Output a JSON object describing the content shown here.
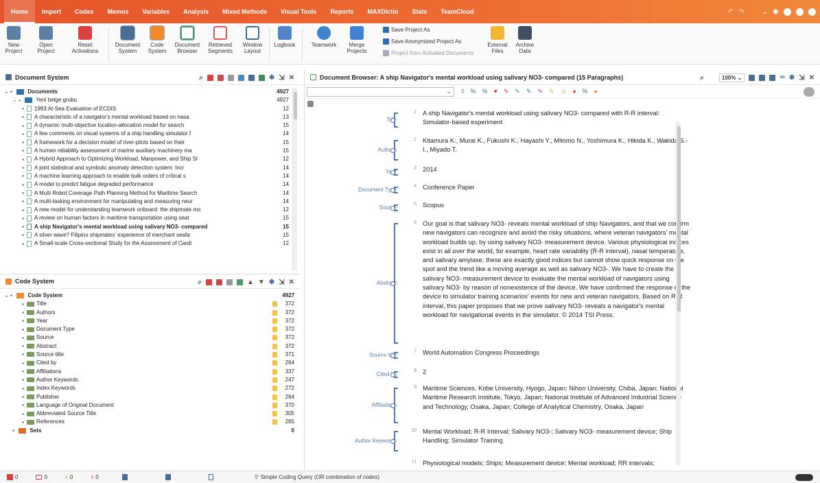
{
  "menu": {
    "items": [
      "Home",
      "Import",
      "Codes",
      "Memos",
      "Variables",
      "Analysis",
      "Mixed Methods",
      "Visual Tools",
      "Reports",
      "MAXDictio",
      "Stats",
      "TeamCloud"
    ]
  },
  "ribbon": {
    "new_project": "New\nProject",
    "open_project": "Open\nProject",
    "reset_activations": "Reset\nActivations",
    "document_system": "Document\nSystem",
    "code_system": "Code\nSystem",
    "document_browser": "Document\nBrowser",
    "retrieved_segments": "Retrieved\nSegments",
    "window_layout": "Window\nLayout",
    "logbook": "Logbook",
    "teamwork": "Teamwork",
    "merge_projects": "Merge\nProjects",
    "save_project_as": "Save Project As",
    "save_anonymized": "Save Anonymized Project As",
    "project_from_activated": "Project from Activated Documents",
    "external_files": "External\nFiles",
    "archive_data": "Archive\nData"
  },
  "doc_system": {
    "title": "Document System",
    "root": {
      "label": "Documents",
      "count": "4927"
    },
    "group": {
      "label": "Yeni belge grubu",
      "count": "4927"
    },
    "docs": [
      {
        "label": "1993 At-Sea Evaluation of ECDIS",
        "count": "12"
      },
      {
        "label": "A characteristic of a navigator's mental workload based on nasa",
        "count": "13"
      },
      {
        "label": "A dynamic multi-objective location-allocation model for search",
        "count": "15"
      },
      {
        "label": "A few comments on visual systems of a ship handling simulator f",
        "count": "14"
      },
      {
        "label": "A framework for a decision model of river-pilots based on their",
        "count": "15"
      },
      {
        "label": "A human reliability assessment of marine auxiliary machinery ma",
        "count": "15"
      },
      {
        "label": "A Hybrid Approach to Optimizing Workload, Manpower, and Ship Sl",
        "count": "12"
      },
      {
        "label": "A joint statistical and symbolic anomaly detection system: Incr",
        "count": "14"
      },
      {
        "label": "A machine learning approach to enable bulk orders of critical s",
        "count": "14"
      },
      {
        "label": "A model to predict fatigue degraded performance",
        "count": "14"
      },
      {
        "label": "A Multi Robot Coverage Path Planning Method for Maritime Search",
        "count": "14"
      },
      {
        "label": "A multi-tasking environment for manipulating and measuring neur",
        "count": "14"
      },
      {
        "label": "A new model for understanding teamwork onboard: the shipmate mo",
        "count": "12"
      },
      {
        "label": "A review on human factors in maritime transportation using seat",
        "count": "15"
      },
      {
        "label": "A ship Navigator's mental workload using salivary NO3- compared",
        "count": "15"
      },
      {
        "label": "A silver wave? Filipino shipmates' experience of merchant seafa",
        "count": "15"
      },
      {
        "label": "A Small-scale Cross-sectional Study for the Assessment of Cardi",
        "count": "12"
      }
    ]
  },
  "code_system": {
    "title": "Code System",
    "root": {
      "label": "Code System",
      "count": "4927"
    },
    "codes": [
      {
        "label": "Title",
        "count": "372"
      },
      {
        "label": "Authors",
        "count": "372"
      },
      {
        "label": "Year",
        "count": "372"
      },
      {
        "label": "Document Type",
        "count": "372"
      },
      {
        "label": "Source",
        "count": "372"
      },
      {
        "label": "Abstract",
        "count": "372"
      },
      {
        "label": "Source title",
        "count": "371"
      },
      {
        "label": "Cited by",
        "count": "264"
      },
      {
        "label": "Affiliations",
        "count": "337"
      },
      {
        "label": "Author Keywords",
        "count": "247"
      },
      {
        "label": "Index Keywords",
        "count": "272"
      },
      {
        "label": "Publisher",
        "count": "264"
      },
      {
        "label": "Language of Original Document",
        "count": "370"
      },
      {
        "label": "Abbreviated Source Title",
        "count": "305"
      },
      {
        "label": "References",
        "count": "265"
      }
    ],
    "sets": {
      "label": "Sets",
      "count": "0"
    }
  },
  "browser": {
    "title": "Document Browser: A ship Navigator's mental workload using salivary NO3- compared  (15 Paragraphs)",
    "zoom": "100%",
    "segments": [
      {
        "code": "Title",
        "num": "1",
        "text": "A ship Navigator's mental workload using salivary NO3- compared with R-R interval: Simulator-based experiment"
      },
      {
        "code": "Authors",
        "num": "2",
        "text": "Kitamura K., Murai K., Fukushi K., Hayashi Y., Mitomo N., Yoshimura K., Hikida K., Wakida S.-I., Miyado T."
      },
      {
        "code": "Year",
        "num": "3",
        "text": "2014"
      },
      {
        "code": "Document Type",
        "num": "4",
        "text": "Conference Paper"
      },
      {
        "code": "Source",
        "num": "5",
        "text": "Scopus"
      },
      {
        "code": "Abstract",
        "num": "6",
        "text": "Our goal is that salivary NO3- reveals mental workload of ship Navigators, and that we confirm new navigators can recognize and avoid the risky situations, where veteran navigators' mental workload builds up, by using salivary NO3- measurement device. Various physiological indices exist in all over the world, for example, heart rate variability (R-R interval), nasal temperature, and salivary amylase; these are exactly good indices but cannot show quick response on the spot and the trend like a moving average as well as salivary NO3-. We have to create the salivary NO3- measurement device to evaluate the mental workload of navigators using salivary NO3- by reason of nonexistence of the device. We have confirmed the response of the device to simulator training scenarios' events for new and veteran navigators. Based on R-R interval, this paper proposes that we prove salivary NO3- reveals a navigator's mental workload for navigational events in the simulator. © 2014 TSI Press."
      },
      {
        "code": "Source title",
        "num": "7",
        "text": "World Automation Congress Proceedings"
      },
      {
        "code": "Cited by",
        "num": "8",
        "text": "2"
      },
      {
        "code": "Affiliations",
        "num": "9",
        "text": "Maritime Sciences, Kobe University, Hyogo, Japan; Nihon University, Chiba, Japan; National Maritime Research Institute, Tokyo, Japan; National Institute of Advanced Industrial Science and Technology, Osaka, Japan; College of Analytical Chemistry, Osaka, Japan"
      },
      {
        "code": "Author Keywords",
        "num": "10",
        "text": "Mental Workload; R-R Interval; Salivary NO3-; Salivary NO3- measurement device; Ship Handling; Simulator Training"
      },
      {
        "code": "",
        "num": "11",
        "text": "Physiological models; Ships; Measurement device; Mental workload; RR intervals;"
      }
    ]
  },
  "status": {
    "c1": "0",
    "c2": "0",
    "c3": "0",
    "c4": "0",
    "query": "Simple Coding Query (OR combination of codes)"
  },
  "colors": {
    "accent": "#e8582b",
    "code_blue": "#5577aa"
  }
}
